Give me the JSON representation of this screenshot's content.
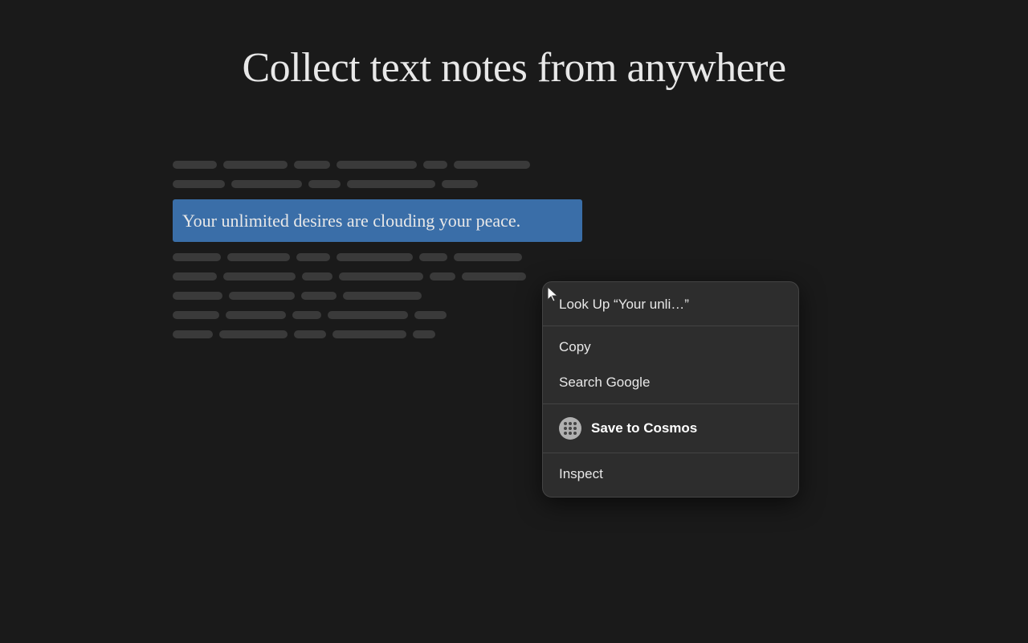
{
  "page": {
    "title": "Collect text notes from anywhere",
    "background_color": "#1a1a1a"
  },
  "selected_text": "Your unlimited desires are clouding your peace.",
  "context_menu": {
    "items": [
      {
        "id": "look-up",
        "label": "Look Up “Your unli…”",
        "has_icon": false,
        "bold": false
      },
      {
        "id": "copy",
        "label": "Copy",
        "has_icon": false,
        "bold": false
      },
      {
        "id": "search-google",
        "label": "Search Google",
        "has_icon": false,
        "bold": false
      },
      {
        "id": "save-to-cosmos",
        "label": "Save to Cosmos",
        "has_icon": true,
        "bold": true
      },
      {
        "id": "inspect",
        "label": "Inspect",
        "has_icon": false,
        "bold": false
      }
    ]
  },
  "text_lines": {
    "before_selected": [
      [
        30,
        45,
        20,
        55,
        15,
        50
      ],
      [
        35,
        48,
        18,
        60,
        22
      ]
    ],
    "after_selected": [
      [
        32,
        42,
        22,
        50,
        18
      ],
      [
        28,
        44,
        20,
        52,
        16,
        45
      ],
      [
        35,
        40,
        25,
        48
      ],
      [
        30,
        50,
        18,
        55,
        20
      ],
      [
        33,
        46,
        22,
        50
      ]
    ]
  }
}
